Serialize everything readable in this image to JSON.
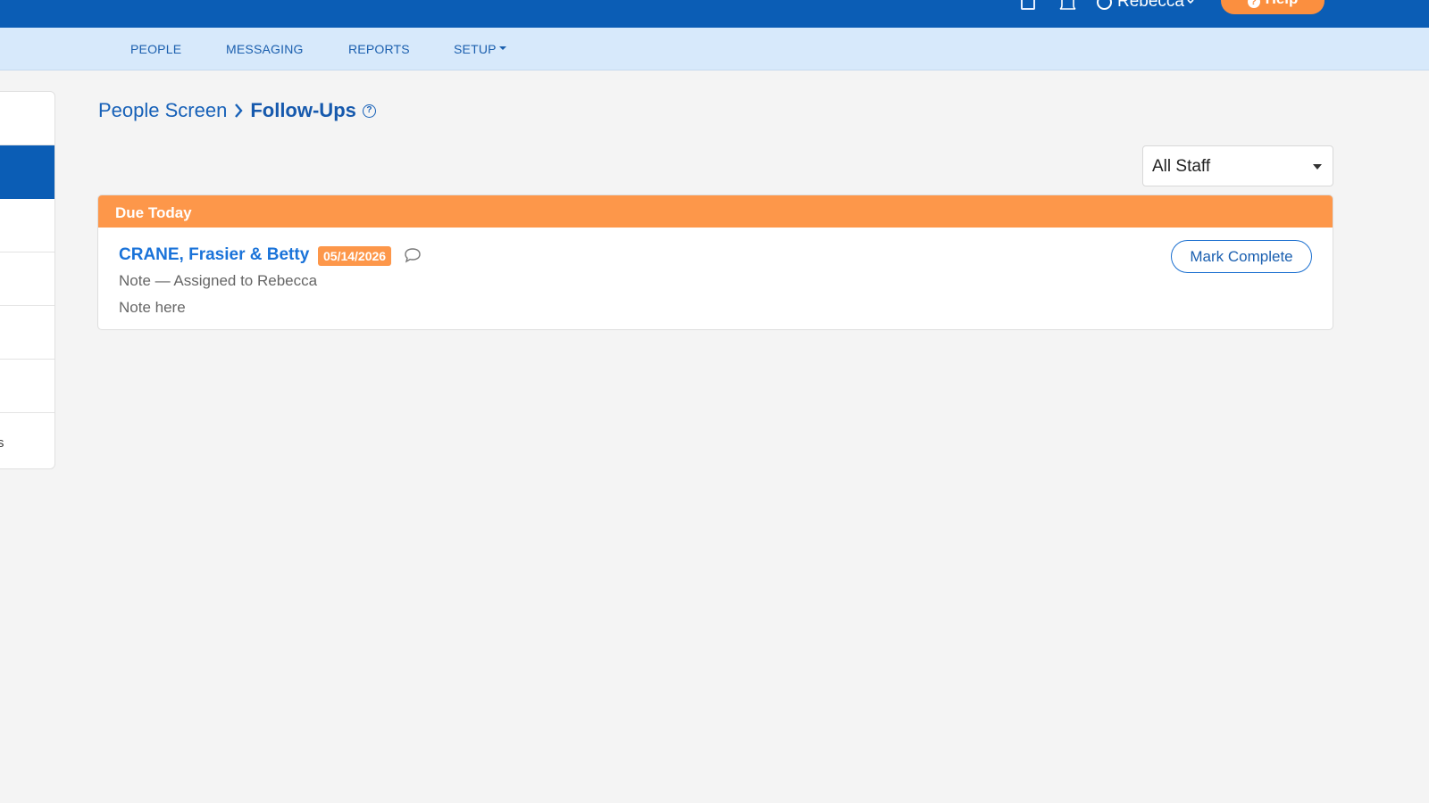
{
  "topbar": {
    "user_name": "Rebecca",
    "help_label": "Help",
    "icons": [
      "box-icon",
      "bell-icon",
      "user-icon",
      "chevron-down-icon",
      "question-icon"
    ]
  },
  "nav": {
    "items": [
      {
        "label": "PEOPLE"
      },
      {
        "label": "MESSAGING"
      },
      {
        "label": "REPORTS"
      },
      {
        "label": "SETUP",
        "has_dropdown": true
      }
    ]
  },
  "sidebar": {
    "partial_label": "s"
  },
  "breadcrumb": {
    "parent": "People Screen",
    "current": "Follow-Ups",
    "help_glyph": "?"
  },
  "staff_filter": {
    "selected": "All Staff"
  },
  "due_today": {
    "header": "Due Today",
    "items": [
      {
        "name": "CRANE, Frasier & Betty",
        "date": "05/14/2026",
        "meta": "Note — Assigned to Rebecca",
        "note": "Note here",
        "action_label": "Mark Complete"
      }
    ]
  },
  "colors": {
    "topbar": "#0b5db5",
    "subnav": "#d7e9fb",
    "accent_orange": "#fd974a",
    "link_blue": "#1a73d9"
  }
}
